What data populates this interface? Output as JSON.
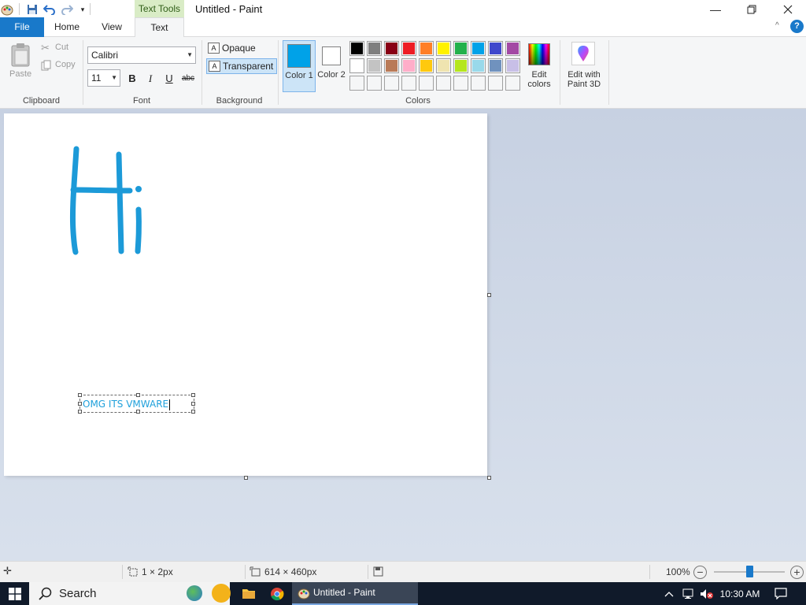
{
  "window": {
    "title": "Untitled - Paint",
    "context_tab_group": "Text Tools",
    "minimize_icon": "minimize-icon",
    "restore_icon": "restore-icon",
    "close_icon": "close-icon"
  },
  "tabs": [
    {
      "label": "File",
      "selected": false
    },
    {
      "label": "Home",
      "selected": false
    },
    {
      "label": "View",
      "selected": false
    },
    {
      "label": "Text",
      "selected": true
    }
  ],
  "ribbon": {
    "clipboard": {
      "group_label": "Clipboard",
      "paste_label": "Paste",
      "cut_label": "Cut",
      "copy_label": "Copy"
    },
    "font": {
      "group_label": "Font",
      "family": "Calibri",
      "size": "11",
      "bold": "B",
      "italic": "I",
      "underline": "U",
      "strike": "abc"
    },
    "background": {
      "group_label": "Background",
      "opaque_label": "Opaque",
      "transparent_label": "Transparent",
      "selected": "Transparent"
    },
    "colors": {
      "group_label": "Colors",
      "color1_label": "Color 1",
      "color2_label": "Color 2",
      "color1_value": "#00a2e8",
      "color2_value": "#ffffff",
      "edit_colors_label": "Edit colors",
      "paint3d_label": "Edit with Paint 3D",
      "palette_row1": [
        "#000000",
        "#7f7f7f",
        "#880015",
        "#ed1c24",
        "#ff7f27",
        "#fff200",
        "#22b14c",
        "#00a2e8",
        "#3f48cc",
        "#a349a4"
      ],
      "palette_row2": [
        "#ffffff",
        "#c3c3c3",
        "#b97a57",
        "#ffaec9",
        "#ffc90e",
        "#efe4b0",
        "#b5e61d",
        "#99d9ea",
        "#7092be",
        "#c8bfe7"
      ],
      "palette_row3": [
        "#f5f6f7",
        "#f5f6f7",
        "#f5f6f7",
        "#f5f6f7",
        "#f5f6f7",
        "#f5f6f7",
        "#f5f6f7",
        "#f5f6f7",
        "#f5f6f7",
        "#f5f6f7"
      ]
    }
  },
  "canvas": {
    "drawing_color": "#1c9ad8",
    "text_box_content": "OMG ITS VMWARE",
    "text_color": "#1fa0db"
  },
  "statusbar": {
    "selection_size": "1 × 2px",
    "canvas_size": "614 × 460px",
    "zoom": "100%",
    "zoom_level": 1.0
  },
  "taskbar": {
    "search_label": "Search",
    "active_app_label": "Untitled - Paint",
    "clock": "10:30 AM"
  }
}
